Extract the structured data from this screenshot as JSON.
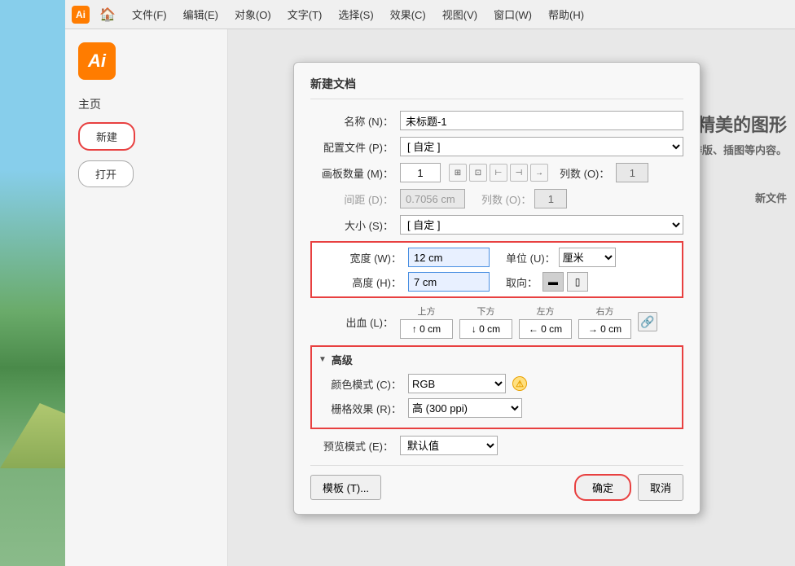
{
  "app": {
    "logo_text": "Ai",
    "home_icon": "🏠"
  },
  "menu": {
    "items": [
      {
        "label": "文件(F)"
      },
      {
        "label": "编辑(E)"
      },
      {
        "label": "对象(O)"
      },
      {
        "label": "文字(T)"
      },
      {
        "label": "选择(S)"
      },
      {
        "label": "效果(C)"
      },
      {
        "label": "视图(V)"
      },
      {
        "label": "窗口(W)"
      },
      {
        "label": "帮助(H)"
      }
    ]
  },
  "sidebar": {
    "title": "主页",
    "new_btn": "新建",
    "open_btn": "打开"
  },
  "right": {
    "big_text": "精美的图形",
    "sub_text": "排版、插图等内容。",
    "new_file_text": "新文件"
  },
  "dialog": {
    "title": "新建文档",
    "fields": {
      "name_label": "名称 (N)：",
      "name_value": "未标题-1",
      "profile_label": "配置文件 (P)：",
      "profile_value": "[ 自定 ]",
      "artboard_label": "画板数量 (M)：",
      "artboard_value": "1",
      "spacing_label": "间距 (D)：",
      "spacing_value": "0.7056 cm",
      "columns_label": "列数 (O)：",
      "columns_value": "1",
      "size_label": "大小 (S)：",
      "size_value": "[ 自定 ]",
      "width_label": "宽度 (W)：",
      "width_value": "12 cm",
      "height_label": "高度 (H)：",
      "height_value": "7 cm",
      "unit_label": "单位 (U)：",
      "unit_value": "厘米",
      "orientation_label": "取向：",
      "bleed_label": "出血 (L)：",
      "bleed_top_label": "上方",
      "bleed_top_value": "0 cm",
      "bleed_bottom_label": "下方",
      "bleed_bottom_value": "0 cm",
      "bleed_left_label": "左方",
      "bleed_left_value": "0 cm",
      "bleed_right_label": "右方",
      "bleed_right_value": "0 cm",
      "advanced_label": "高级",
      "color_mode_label": "颜色模式 (C)：",
      "color_mode_value": "RGB",
      "raster_label": "栅格效果 (R)：",
      "raster_value": "高 (300 ppi)",
      "preview_label": "预览模式 (E)：",
      "preview_value": "默认值"
    },
    "buttons": {
      "template": "模板 (T)...",
      "ok": "确定",
      "cancel": "取消"
    }
  }
}
